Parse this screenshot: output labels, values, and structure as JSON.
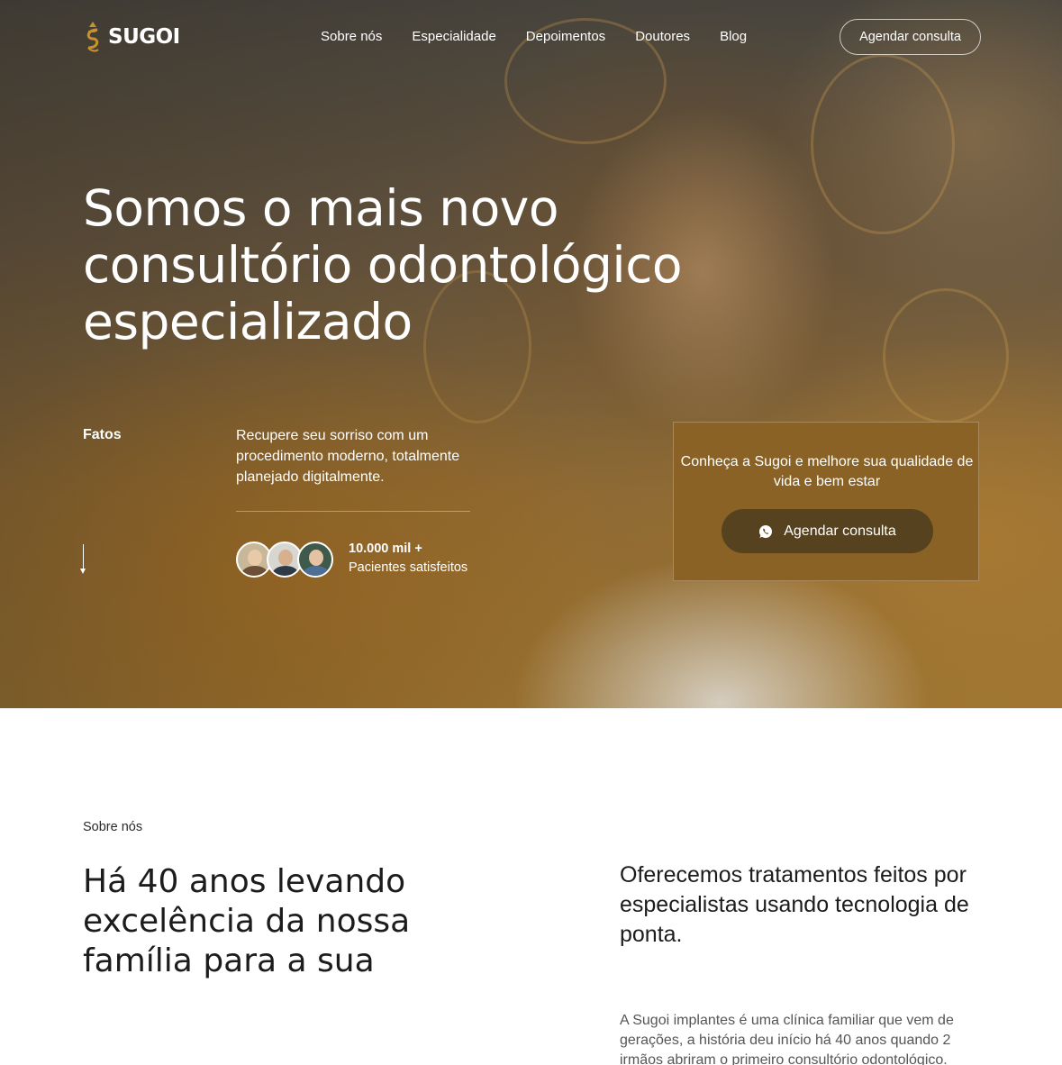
{
  "brand": {
    "name": "SUGOI",
    "accent": "#c8912f",
    "panel_color": "#8a6225"
  },
  "nav": {
    "items": [
      {
        "label": "Sobre nós"
      },
      {
        "label": "Especialidade"
      },
      {
        "label": "Depoimentos"
      },
      {
        "label": "Doutores"
      },
      {
        "label": "Blog"
      }
    ],
    "cta_label": "Agendar consulta"
  },
  "hero": {
    "title": "Somos o mais novo consultório odontológico especializado",
    "facts_label": "Fatos",
    "description": "Recupere seu sorriso com um procedimento moderno, totalmente planejado digitalmente.",
    "stat_value": "10.000 mil +",
    "stat_label": "Pacientes satisfeitos",
    "arrow_icon": "arrow-down-icon",
    "avatars": [
      "avatar-woman",
      "avatar-man",
      "avatar-man-glasses"
    ]
  },
  "cta_card": {
    "text": "Conheça a Sugoi e melhore sua qualidade de vida e bem estar",
    "button_label": "Agendar consulta",
    "button_icon": "whatsapp-icon"
  },
  "about": {
    "kicker": "Sobre nós",
    "title": "Há 40 anos levando excelência da nossa família para a sua",
    "lead": "Oferecemos tratamentos feitos por especialistas usando tecnologia de ponta.",
    "body": "A Sugoi implantes é uma clínica familiar que vem de gerações, a história deu início há 40 anos quando 2 irmãos abriram o primeiro consultório odontológico."
  }
}
